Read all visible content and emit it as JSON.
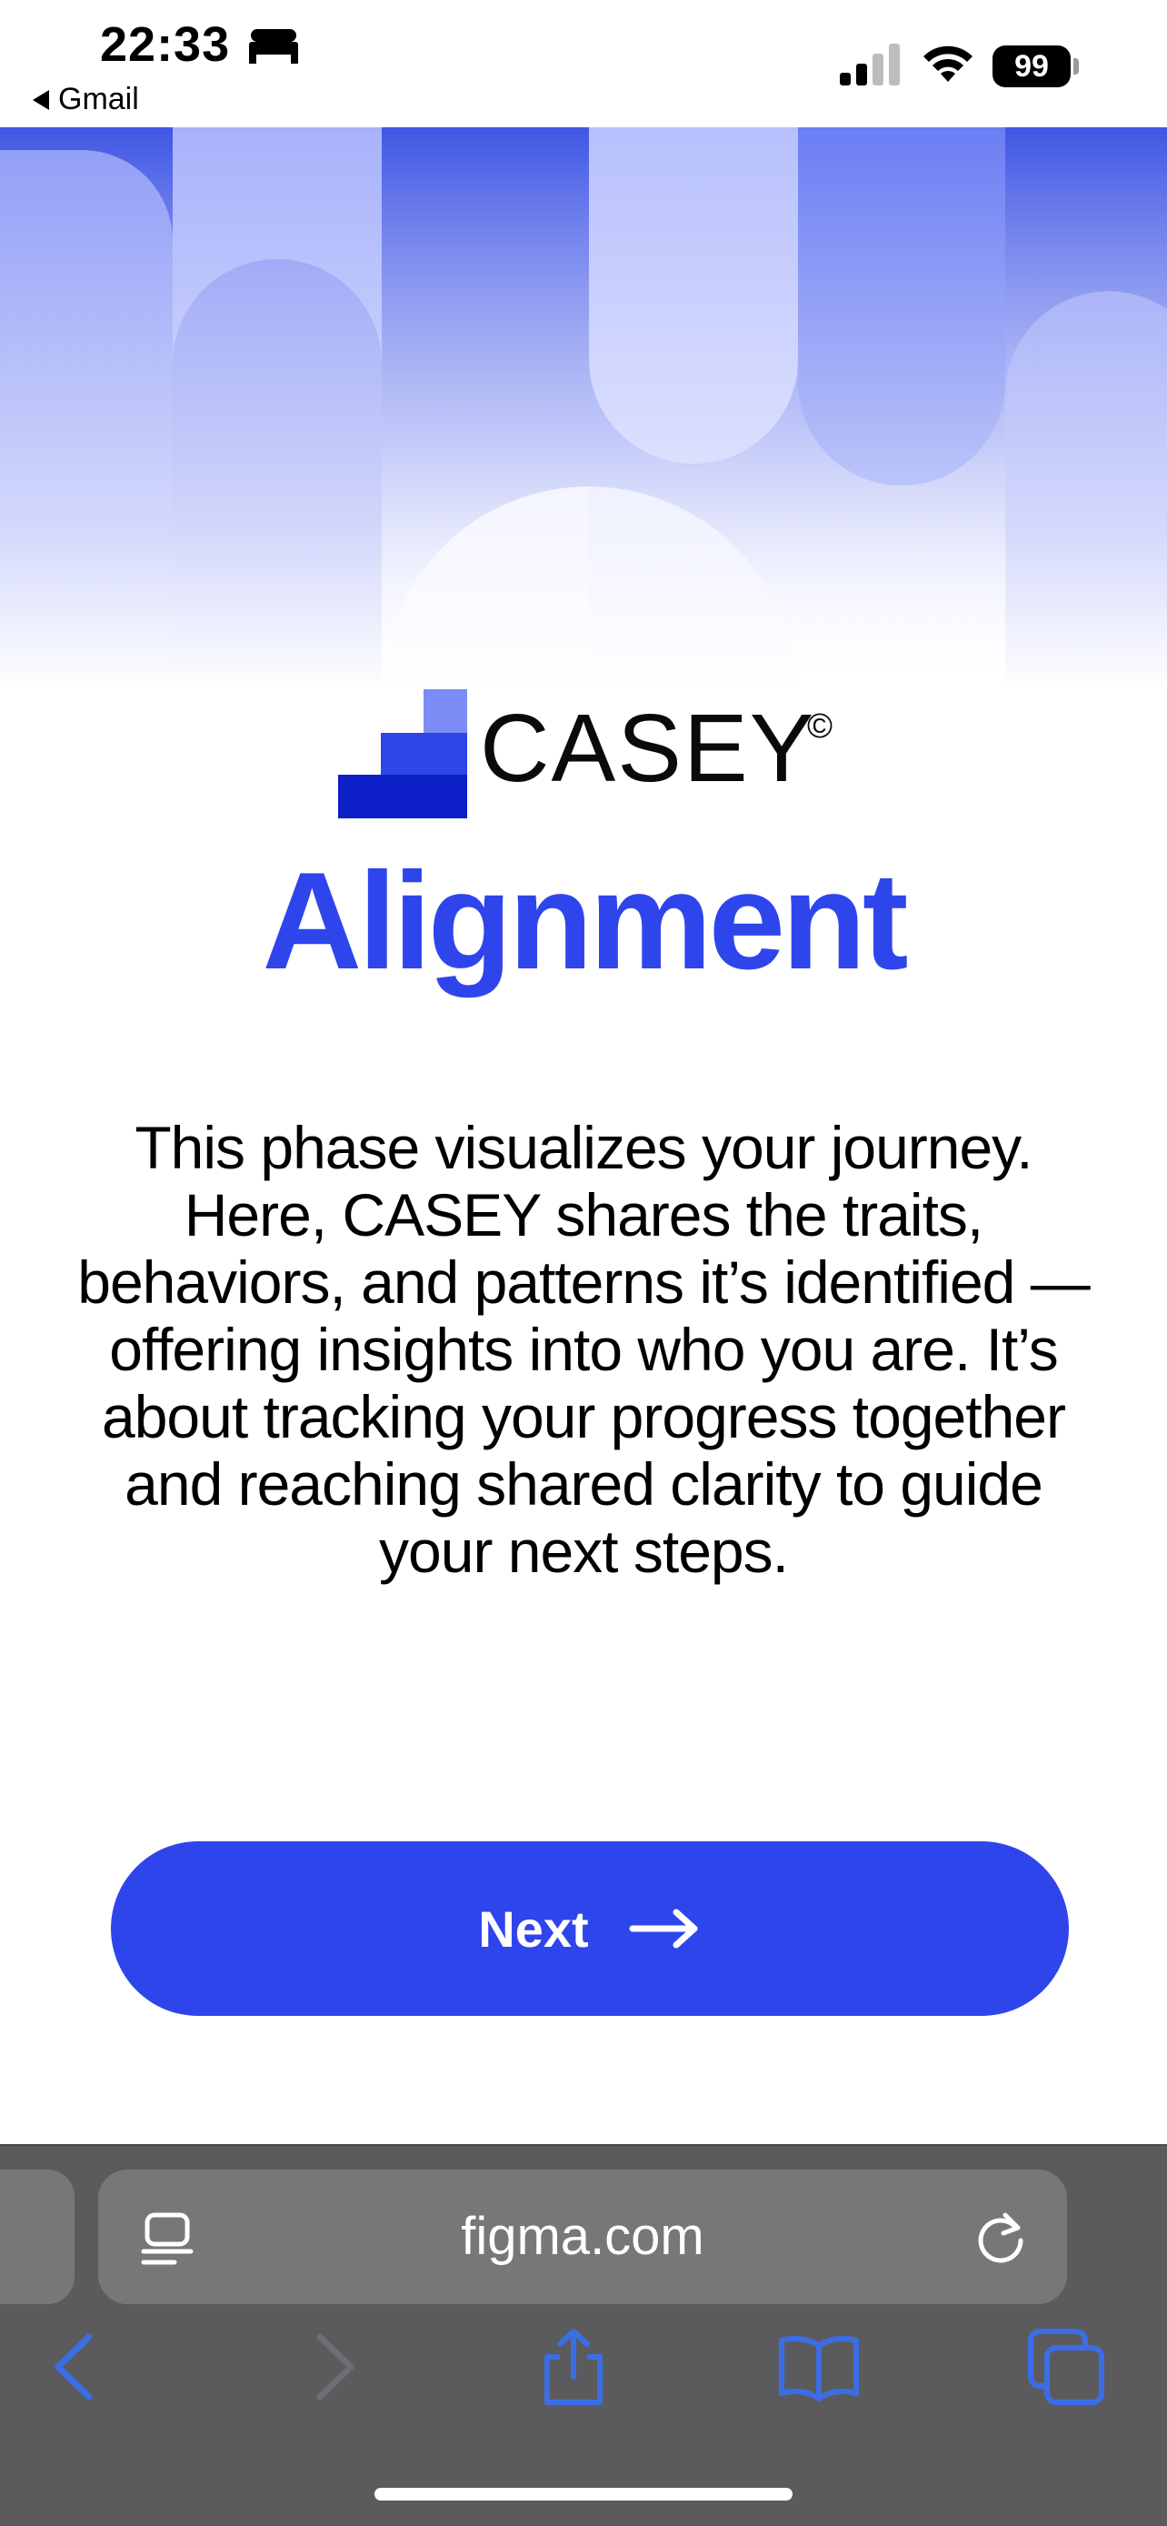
{
  "status_bar": {
    "time": "22:33",
    "back_app": "Gmail",
    "battery": "99"
  },
  "logo": {
    "name": "CASEY",
    "mark": "©"
  },
  "title": "Alignment",
  "description": "This phase visualizes your journey. Here, CASEY shares the traits, behaviors, and patterns it’s identified — offering insights into who you are. It’s about tracking your progress together and reaching shared clarity to guide your next steps.",
  "next_button": {
    "label": "Next"
  },
  "browser": {
    "url": "figma.com"
  },
  "colors": {
    "accent": "#2f45ec",
    "hero_light": "#c7ceff",
    "hero_dark": "#3a4fe0",
    "browser_bg": "#5b5b5e",
    "toolbar_icon": "#3b6ee6"
  }
}
